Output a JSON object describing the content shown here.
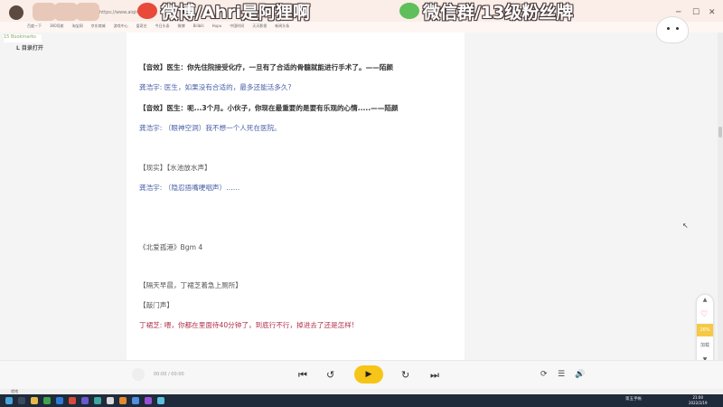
{
  "browser": {
    "url": "https://www.aiqin",
    "bookmarks": [
      "百度一下",
      "360导航",
      "淘宝网",
      "京东商城",
      "游戏中心",
      "爱奇艺",
      "今日头条",
      "微博",
      "Bilibili",
      "Hupu",
      "中国时间",
      "天天影视",
      "新闻头条"
    ],
    "left_tab": "15 Bookmarks",
    "zoom_label": "L 目录打开"
  },
  "overlay": {
    "weibo_text": "微博/Ahri是阿狸啊",
    "wechat_text": "微信群/13级粉丝牌"
  },
  "content": {
    "lines": [
      "【音效】医生：你先住院接受化疗，一旦有了合适的骨髓就能进行手术了。——陌颜",
      "龚浩宇: 医生，如果没有合适的，最多还能活多久?",
      "【音效】医生：呃...3个月。小伙子，你现在最重要的是要有乐观的心情.....——陌颜",
      "龚浩宇: （眼神空洞）我不想一个人死在医院。",
      "【现实】【水池放水声】",
      "龚浩宇: （隐忍捂嘴哽咽声）……",
      "《北爱孤港》Bgm 4",
      "【隔天早晨，丁裙芝着急上厕所】",
      "【敲门声】",
      "丁裙芝: 喂，你都在里面待40分钟了，到底行不行，掉进去了还是怎样!"
    ]
  },
  "fab": {
    "up": "▲",
    "heart": "♡",
    "progress": "26%",
    "label": "加载",
    "down": "▼"
  },
  "player": {
    "time": "00:00 / 00:00",
    "prev": "⏮",
    "rewind": "↺",
    "play": "▶",
    "forward": "↻",
    "next": "⏭",
    "loop": "⟳",
    "list": "☰",
    "volume": "🔊"
  },
  "statusbar": "就绪",
  "taskbar": {
    "tray": "第五手帐",
    "time": "21:00",
    "date": "2022/2/19"
  },
  "colors": {
    "accent": "#f6c517",
    "blue_text": "#4a62a8",
    "red_text": "#b0304a"
  }
}
